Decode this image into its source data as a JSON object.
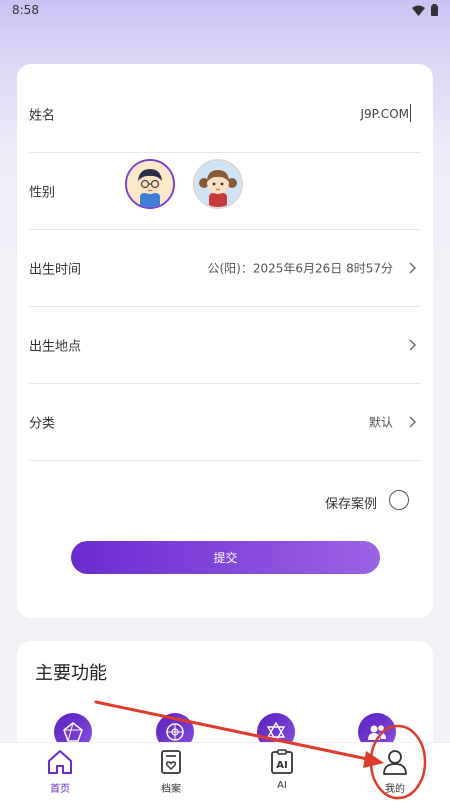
{
  "status_bar": {
    "time": "8:58"
  },
  "form": {
    "name_label": "姓名",
    "name_value": "J9P.COM",
    "gender_label": "性别",
    "birth_time_label": "出生时间",
    "birth_time_value": "公(阳)：2025年6月26日 8时57分",
    "birth_place_label": "出生地点",
    "category_label": "分类",
    "category_value": "默认",
    "save_case_label": "保存案例",
    "submit_label": "提交"
  },
  "features": {
    "title": "主要功能"
  },
  "bottom_nav": [
    {
      "label": "首页",
      "icon": "home-icon",
      "active": true
    },
    {
      "label": "档案",
      "icon": "archive-icon",
      "active": false
    },
    {
      "label": "AI",
      "icon": "ai-icon",
      "active": false
    },
    {
      "label": "我的",
      "icon": "profile-icon",
      "active": false
    }
  ],
  "colors": {
    "accent": "#6a2bd0",
    "annotation": "#e03a2a"
  }
}
